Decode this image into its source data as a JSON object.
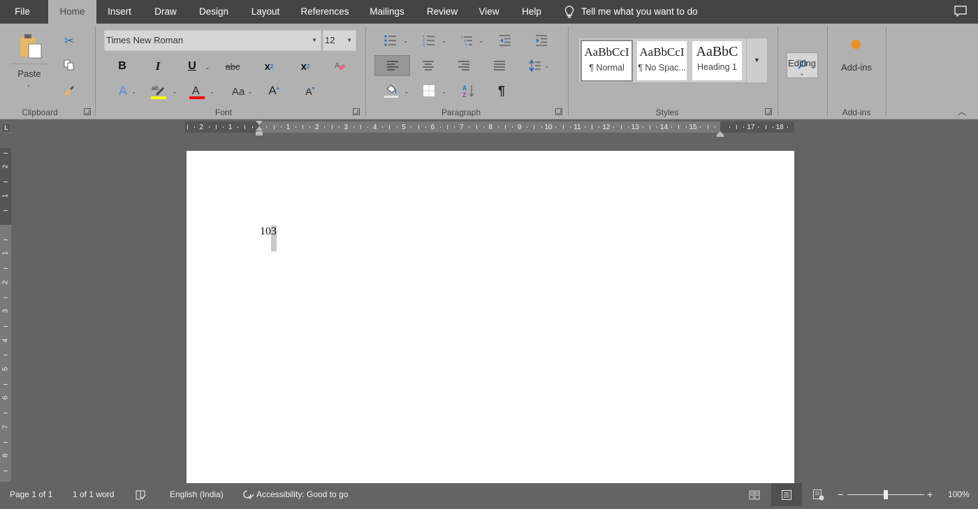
{
  "tabs": [
    {
      "label": "File",
      "active": false
    },
    {
      "label": "Home",
      "active": true
    },
    {
      "label": "Insert",
      "active": false
    },
    {
      "label": "Draw",
      "active": false
    },
    {
      "label": "Design",
      "active": false
    },
    {
      "label": "Layout",
      "active": false
    },
    {
      "label": "References",
      "active": false
    },
    {
      "label": "Mailings",
      "active": false
    },
    {
      "label": "Review",
      "active": false
    },
    {
      "label": "View",
      "active": false
    },
    {
      "label": "Help",
      "active": false
    }
  ],
  "tell_me": {
    "placeholder": "Tell me what you want to do",
    "icon": "lightbulb-icon"
  },
  "comments_icon": "comment-icon",
  "ribbon": {
    "clipboard": {
      "label": "Clipboard",
      "paste_label": "Paste",
      "buttons": [
        "cut-icon",
        "copy-icon",
        "format-painter-icon"
      ]
    },
    "font": {
      "label": "Font",
      "font_name": "Times New Roman",
      "font_size": "12",
      "row1": [
        "Bold",
        "Italic",
        "Underline",
        "Strikethrough",
        "Subscript",
        "Superscript",
        "Clear Formatting"
      ],
      "row1_glyphs": [
        "B",
        "I",
        "U",
        "abc",
        "x",
        "x",
        ""
      ],
      "row2": [
        "Text Effects",
        "Text Highlight Color",
        "Font Color",
        "Change Case",
        "Grow Font",
        "Shrink Font"
      ],
      "change_case_glyph": "Aa",
      "highlight_color": "#ffff00",
      "font_color": "#ff0000"
    },
    "paragraph": {
      "label": "Paragraph",
      "pilcrow": "¶"
    },
    "styles": {
      "label": "Styles",
      "items": [
        {
          "sample": "AaBbCcI",
          "name": "¶ Normal",
          "selected": true
        },
        {
          "sample": "AaBbCcI",
          "name": "¶ No Spac...",
          "selected": false
        },
        {
          "sample": "AaBbC",
          "name": "Heading 1",
          "selected": false
        }
      ]
    },
    "editing": {
      "label": "Editing"
    },
    "addins": {
      "label": "Add-ins",
      "group_label": "Add-ins",
      "accent": "#f0901e"
    }
  },
  "ruler": {
    "h_left_ticks": [
      "2",
      "1"
    ],
    "h_ticks": [
      "1",
      "2",
      "3",
      "4",
      "5",
      "6",
      "7",
      "8",
      "9",
      "10",
      "11",
      "12",
      "13",
      "14",
      "15"
    ],
    "h_right_ticks": [
      "17",
      "18"
    ],
    "v_top_ticks": [
      "2",
      "1"
    ],
    "v_ticks": [
      "1",
      "2",
      "3",
      "4",
      "5",
      "6",
      "7",
      "8"
    ],
    "tab_selector": "L"
  },
  "document": {
    "text_before": "10",
    "text_selected": "3"
  },
  "status": {
    "page": "Page 1 of 1",
    "words": "1 of 1 word",
    "language": "English (India)",
    "accessibility": "Accessibility: Good to go",
    "zoom_level": "100%",
    "zoom_minus": "−",
    "zoom_plus": "+",
    "zoom_fraction": 0.5
  }
}
